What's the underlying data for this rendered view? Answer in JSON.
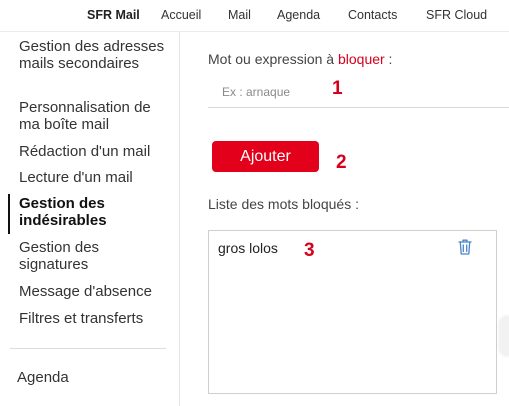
{
  "topnav": {
    "items": [
      {
        "label": "SFR Mail",
        "active": true
      },
      {
        "label": "Accueil"
      },
      {
        "label": "Mail"
      },
      {
        "label": "Agenda"
      },
      {
        "label": "Contacts"
      },
      {
        "label": "SFR Cloud"
      }
    ]
  },
  "sidebar": {
    "items": [
      {
        "label": "Gestion des adresses mails secondaires"
      },
      {
        "label": "Personnalisation de ma boîte mail"
      },
      {
        "label": "Rédaction d'un mail"
      },
      {
        "label": "Lecture d'un mail"
      },
      {
        "label": "Gestion des indésirables",
        "active": true
      },
      {
        "label": "Gestion des signatures"
      },
      {
        "label": "Message d'absence"
      },
      {
        "label": "Filtres et transferts"
      }
    ],
    "agenda_label": "Agenda"
  },
  "form": {
    "label_prefix": "Mot ou expression à ",
    "label_accent": "bloquer",
    "label_suffix": " :",
    "input_placeholder": "Ex : arnaque",
    "input_value": "",
    "add_button_label": "Ajouter",
    "list_label": "Liste des mots bloqués :",
    "blocked_words": [
      "gros lolos"
    ]
  },
  "annotations": {
    "one": "1",
    "two": "2",
    "three": "3"
  },
  "colors": {
    "accent": "#e2001a",
    "accent_text": "#d6001c",
    "trash_icon": "#4a86c7"
  },
  "icons": {
    "delete": "trash-icon"
  }
}
